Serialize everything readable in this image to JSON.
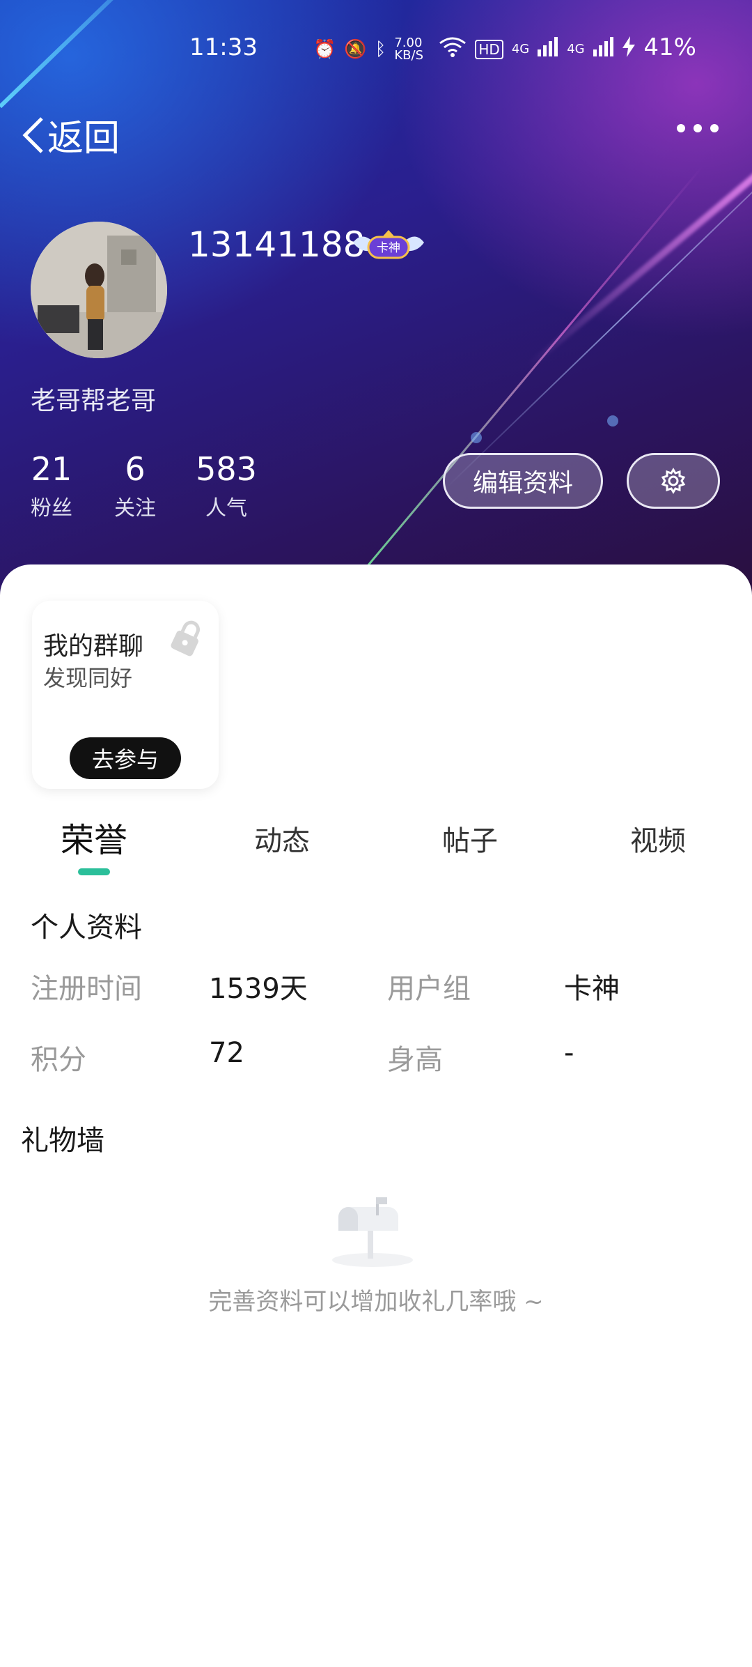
{
  "status_bar": {
    "time": "11:33",
    "net_speed": "7.00 KB/S",
    "hd": "HD",
    "sig1": "4G",
    "sig2": "4G",
    "battery": "41%"
  },
  "nav": {
    "back_label": "返回"
  },
  "profile": {
    "user_id": "13141188",
    "badge_text": "卡神",
    "nickname": "老哥帮老哥",
    "stats": [
      {
        "value": "21",
        "label": "粉丝"
      },
      {
        "value": "6",
        "label": "关注"
      },
      {
        "value": "583",
        "label": "人气"
      }
    ],
    "edit_button": "编辑资料"
  },
  "group_card": {
    "title": "我的群聊",
    "subtitle": "发现同好",
    "join_button": "去参与"
  },
  "tabs": [
    {
      "label": "荣誉",
      "active": true
    },
    {
      "label": "动态",
      "active": false
    },
    {
      "label": "帖子",
      "active": false
    },
    {
      "label": "视频",
      "active": false
    }
  ],
  "personal_info": {
    "title": "个人资料",
    "rows": [
      [
        {
          "label": "注册时间",
          "value": "1539天"
        },
        {
          "label": "用户组",
          "value": "卡神"
        }
      ],
      [
        {
          "label": "积分",
          "value": "72"
        },
        {
          "label": "身高",
          "value": "-"
        }
      ]
    ]
  },
  "gift_wall": {
    "title": "礼物墙",
    "empty_text": "完善资料可以增加收礼几率哦 ~"
  },
  "colors": {
    "tab_indicator": "#2bbf9a",
    "join_button_bg": "#111111"
  }
}
